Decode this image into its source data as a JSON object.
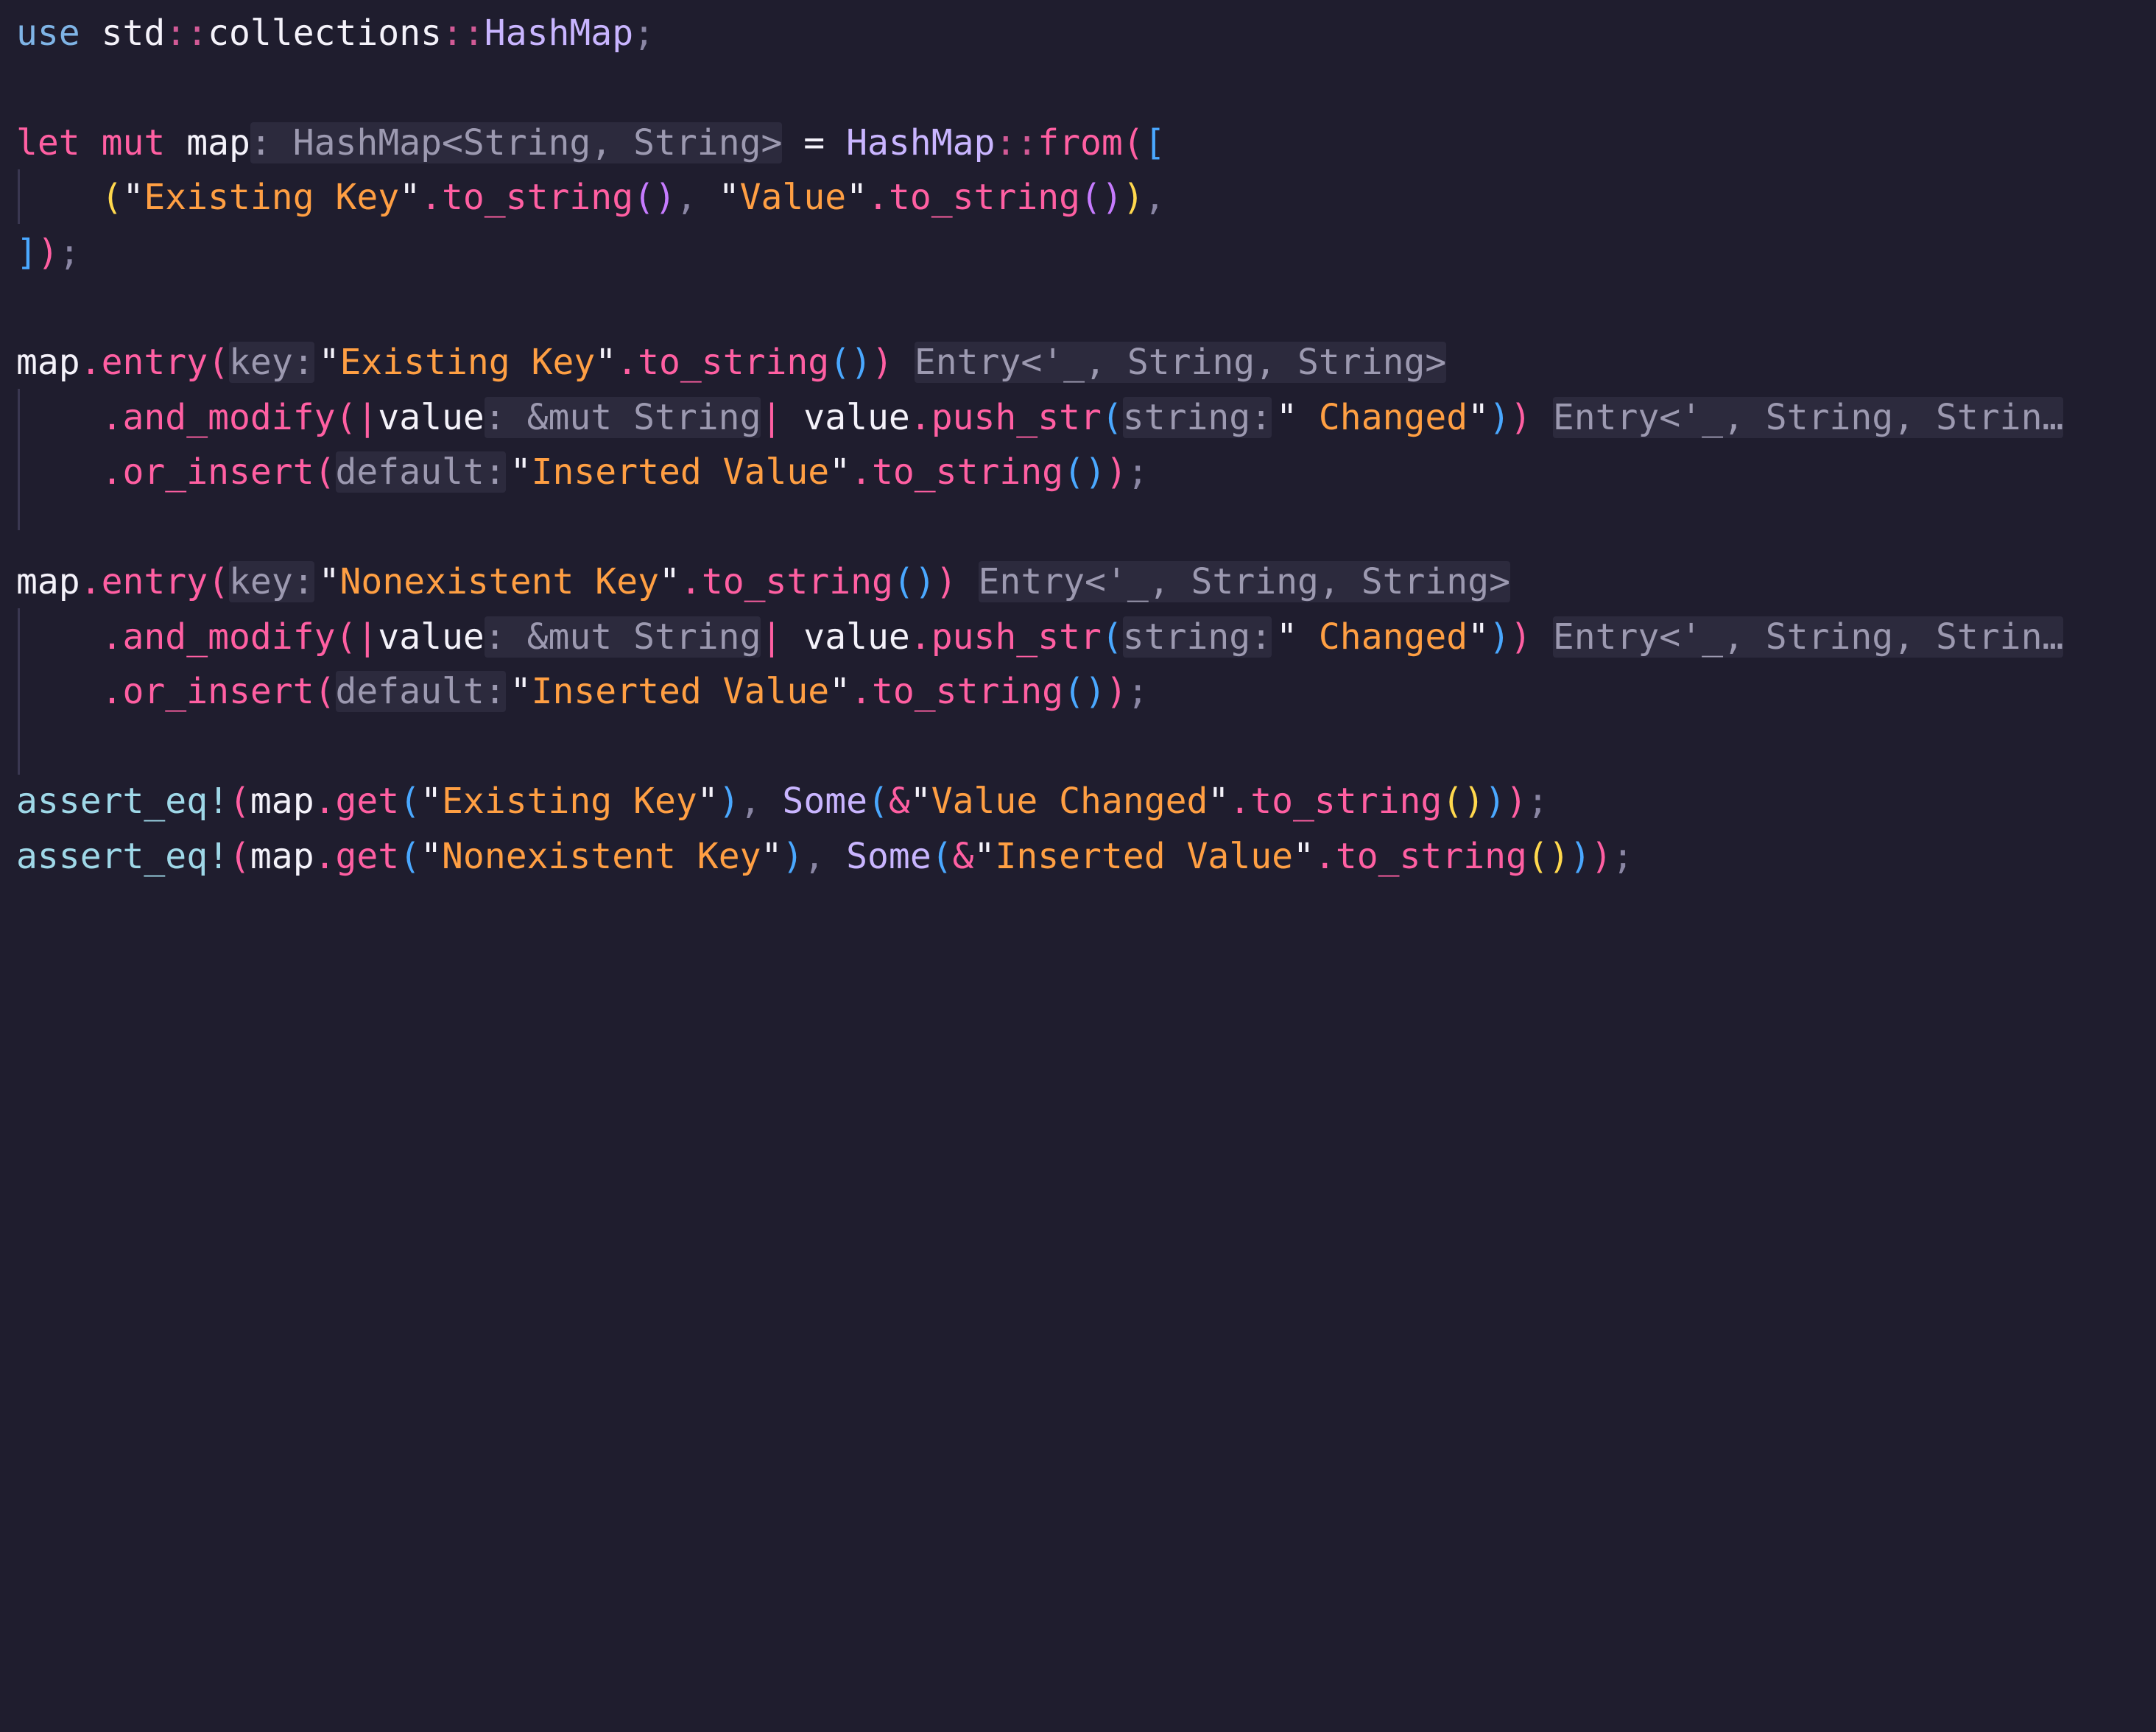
{
  "editor": {
    "language": "rust",
    "lines": [
      "use std::collections::HashMap;",
      "",
      "let mut map: HashMap<String, String> = HashMap::from([",
      "    (\"Existing Key\".to_string(), \"Value\".to_string()),",
      "]);",
      "",
      "map.entry(key: \"Existing Key\".to_string()) Entry<'_, String, String>",
      "    .and_modify(|value: &mut String| value.push_str(string: \" Changed\")) Entry<'_, String, Strin…",
      "    .or_insert(default: \"Inserted Value\".to_string());",
      "",
      "map.entry(key: \"Nonexistent Key\".to_string()) Entry<'_, String, String>",
      "    .and_modify(|value: &mut String| value.push_str(string: \" Changed\")) Entry<'_, String, Strin…",
      "    .or_insert(default: \"Inserted Value\".to_string());",
      "",
      "assert_eq!(map.get(\"Existing Key\"), Some(&\"Value Changed\".to_string()));",
      "assert_eq!(map.get(\"Nonexistent Key\"), Some(&\"Inserted Value\".to_string()));"
    ]
  },
  "tokens": {
    "use": "use",
    "std": "std",
    "sep": "::",
    "collections": "collections",
    "hashmap": "HashMap",
    "semi": ";",
    "let": "let",
    "mut": "mut",
    "map": "map",
    "type_hint_map": ": HashMap<String, String>",
    "eq": " = ",
    "from": "from",
    "open_paren": "(",
    "close_paren": ")",
    "open_bracket": "[",
    "close_bracket": "]",
    "comma": ",",
    "quote": "\"",
    "existing_key": "Existing Key",
    "nonexistent_key": "Nonexistent Key",
    "value_str": "Value",
    "dot": ".",
    "to_string": "to_string",
    "entry": "entry",
    "key_hint": "key:",
    "entry_hint": "Entry<'_, String, String>",
    "entry_hint_truncated": "Entry<'_, String, Strin…",
    "and_modify": "and_modify",
    "pipe": "|",
    "value": "value",
    "value_type_hint": ": &mut String",
    "push_str": "push_str",
    "string_hint": "string:",
    "changed": " Changed",
    "or_insert": "or_insert",
    "default_hint": "default:",
    "inserted_value": "Inserted Value",
    "assert_eq": "assert_eq!",
    "get": "get",
    "some": "Some",
    "amp": "&",
    "value_changed": "Value Changed"
  },
  "colors": {
    "background": "#1f1d2e",
    "keyword_use": "#7fb4e6",
    "keyword_let": "#ff5fa2",
    "type": "#c9b5ff",
    "string": "#ff9f43",
    "method": "#ff5fa2",
    "macro": "#9fd8e8",
    "inlay_hint_text": "#9c99b0",
    "inlay_hint_bg": "#2c2a3d"
  }
}
